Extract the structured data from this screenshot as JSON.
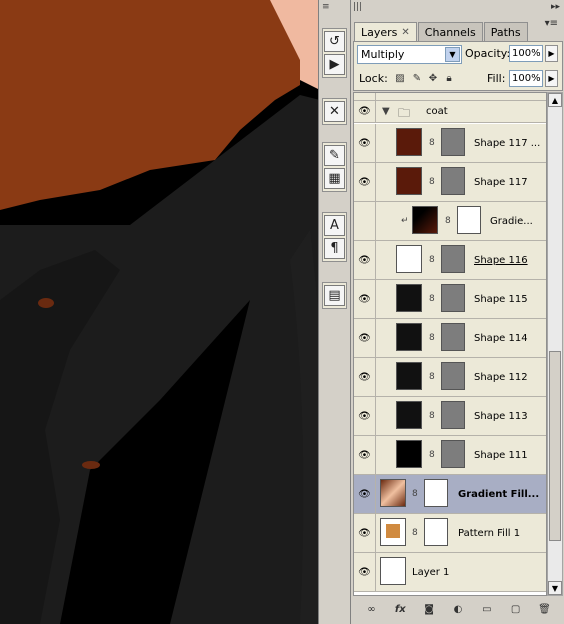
{
  "tabs": [
    {
      "label": "Layers",
      "active": true
    },
    {
      "label": "Channels",
      "active": false
    },
    {
      "label": "Paths",
      "active": false
    }
  ],
  "blend_mode": "Multiply",
  "opacity_label": "Opacity:",
  "opacity_value": "100%",
  "lock_label": "Lock:",
  "fill_label": "Fill:",
  "fill_value": "100%",
  "group_name": "coat",
  "layers": [
    {
      "name": "Shape 117 ...",
      "thumb_color": "#5a1a0a"
    },
    {
      "name": "Shape 117",
      "thumb_color": "#5a1a0a"
    },
    {
      "name": "Gradie...",
      "thumb_color": "#2a0f08"
    },
    {
      "name": "Shape 116",
      "thumb_color": "#ffffff"
    },
    {
      "name": "Shape 115",
      "thumb_color": "#111111"
    },
    {
      "name": "Shape 114",
      "thumb_color": "#111111"
    },
    {
      "name": "Shape 112",
      "thumb_color": "#111111"
    },
    {
      "name": "Shape 113",
      "thumb_color": "#111111"
    },
    {
      "name": "Shape 111",
      "thumb_color": "#000000"
    },
    {
      "name": "Gradient Fill...",
      "thumb_color": "#b46a48"
    },
    {
      "name": "Pattern Fill 1",
      "thumb_color": "#d08a40"
    },
    {
      "name": "Layer 1",
      "thumb_color": "#ffffff"
    }
  ],
  "colors": {
    "coat_dark": "#0a0a0a",
    "coat_gray": "#1c1c1c",
    "hair_brown": "#8a3a14",
    "skin": "#f0b9a0",
    "panel_bg": "#d4d0c8",
    "selected_row": "#a8aec4"
  },
  "icons": {
    "eye": "eye-icon",
    "chain": "link-icon",
    "folder": "folder-icon"
  }
}
